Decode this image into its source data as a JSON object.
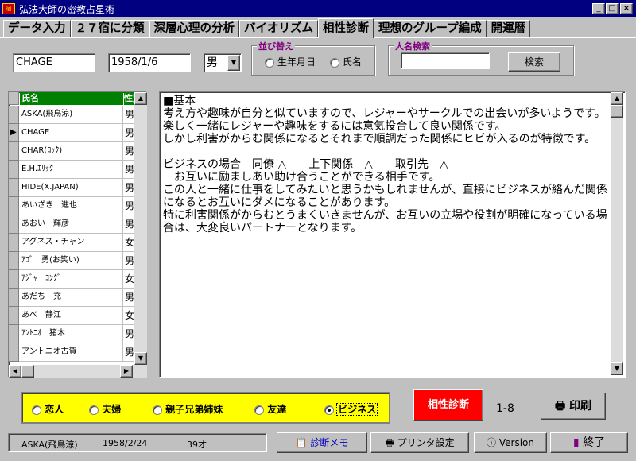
{
  "window": {
    "title": "弘法大師の密教占星術",
    "icon_text": "宿"
  },
  "tabs": [
    "データ入力",
    "２７宿に分類",
    "深層心理の分析",
    "バイオリズム",
    "相性診断",
    "理想のグループ編成",
    "開運暦"
  ],
  "active_tab": "相性診断",
  "inputs": {
    "name": "CHAGE",
    "birthdate": "1958/1/6",
    "sex": "男"
  },
  "sort": {
    "title": "並び替え",
    "options": [
      "生年月日",
      "氏名"
    ]
  },
  "name_search": {
    "title": "人名検索",
    "value": "",
    "button": "検索"
  },
  "list": {
    "headers": [
      "氏名",
      "性別"
    ],
    "rows": [
      {
        "name": "ASKA(飛鳥涼)",
        "sex": "男"
      },
      {
        "name": "CHAGE",
        "sex": "男"
      },
      {
        "name": "CHAR(ﾛｯｸ)",
        "sex": "男"
      },
      {
        "name": "E.H.ｴﾘｯｸ",
        "sex": "男"
      },
      {
        "name": "HIDE(X.JAPAN)",
        "sex": "男"
      },
      {
        "name": "あいざき　進也",
        "sex": "男"
      },
      {
        "name": "あおい　輝彦",
        "sex": "男"
      },
      {
        "name": "アグネス・チャン",
        "sex": "女"
      },
      {
        "name": "ｱｺﾞ　勇(お笑い)",
        "sex": "男"
      },
      {
        "name": "ｱｼﾞｬ　ｺﾝｸﾞ",
        "sex": "女"
      },
      {
        "name": "あだち　充",
        "sex": "男"
      },
      {
        "name": "あべ　静江",
        "sex": "女"
      },
      {
        "name": "ｱﾝﾄﾆｵ　猪木",
        "sex": "男"
      },
      {
        "name": "アントニオ古賀",
        "sex": "男"
      }
    ],
    "current_row": 1
  },
  "result_text": "■基本\n考え方や趣味が自分と似ていますので、レジャーやサークルでの出会いが多いようです。\n楽しく一緒にレジャーや趣味をするには意気投合して良い関係です。\nしかし利害がからむ関係になるとそれまで順調だった関係にヒビが入るのが特徴です。\n\nビジネスの場合　同僚 △　　上下関係　△　　取引先　△\n　お互いに励ましあい助け合うことができる相手です。\nこの人と一緒に仕事をしてみたいと思うかもしれませんが、直接にビジネスが絡んだ関係になるとお互いにダメになることがあります。\n特に利害関係がからむとうまくいきませんが、お互いの立場や役割が明確になっている場合は、大変良いパートナーとなります。",
  "relations": {
    "options": [
      "恋人",
      "夫婦",
      "親子兄弟姉妹",
      "友達",
      "ビジネス"
    ],
    "selected": "ビジネス"
  },
  "diagnose_button": "相性診断",
  "page_indicator": "1-8",
  "print_button": "印刷",
  "status": {
    "name": "ASKA(飛鳥涼)",
    "birthdate": "1958/2/24",
    "age": "39才"
  },
  "bottom_buttons": {
    "memo": "診断メモ",
    "printer": "プリンタ設定",
    "version": "Version",
    "exit": "終了"
  },
  "colors": {
    "title_bar": "#000080",
    "header_green": "#008000",
    "highlight_yellow": "#ffff00",
    "diagnose_red": "#ff0000",
    "group_title": "#800080",
    "memo_blue": "#0000c0"
  }
}
